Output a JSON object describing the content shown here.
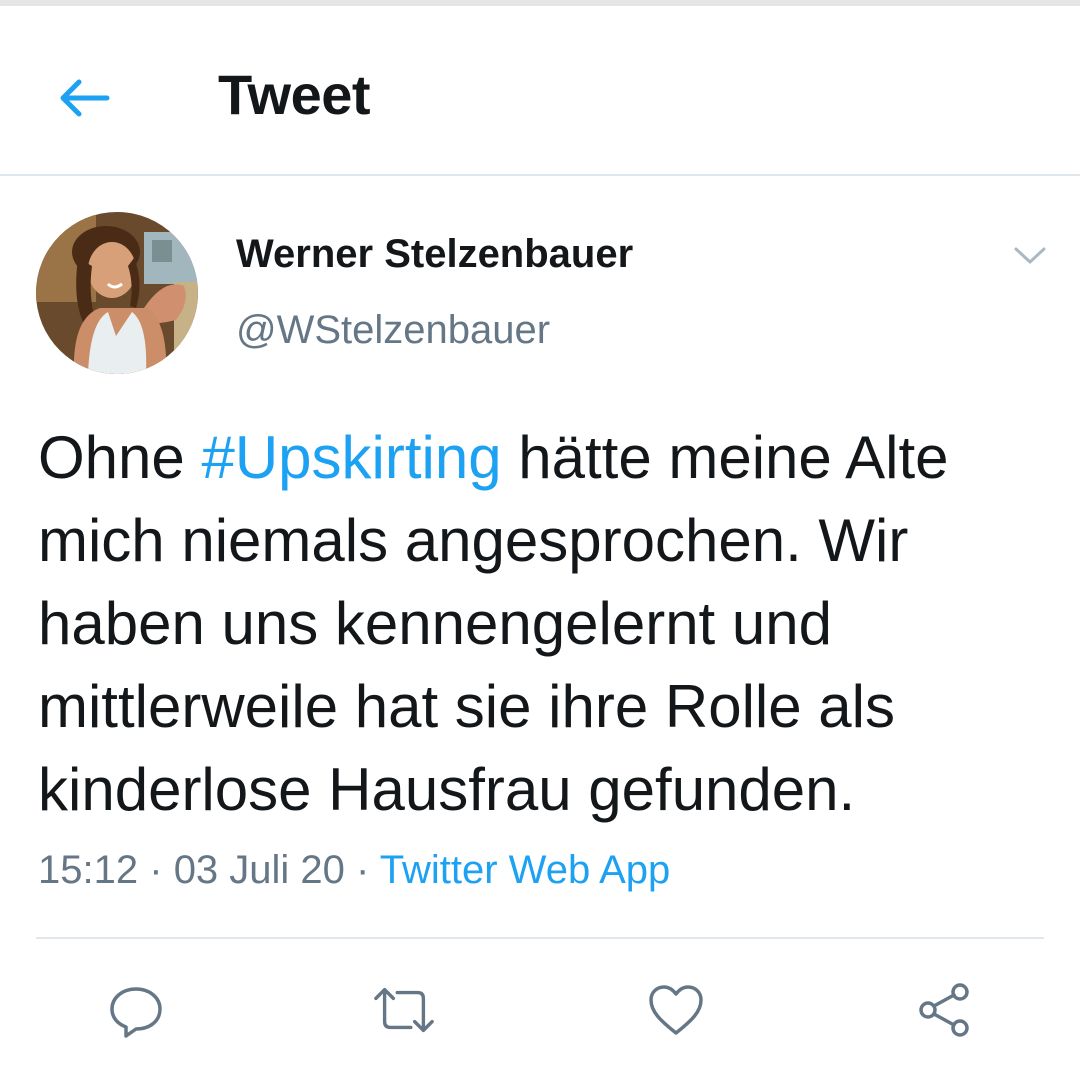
{
  "header": {
    "title": "Tweet",
    "back_icon": "arrow-left-icon"
  },
  "tweet": {
    "author": {
      "display_name": "Werner Stelzenbauer",
      "handle": "@WStelzenbauer"
    },
    "text": {
      "before": "Ohne ",
      "hashtag": "#Upskirting",
      "after": " hätte meine Alte mich niemals angesprochen. Wir haben uns kennengelernt und mittlerweile hat sie ihre Rolle als kinderlose Hausfrau gefunden."
    },
    "time": "15:12",
    "separator": "·",
    "date": "03 Juli 20",
    "source": "Twitter Web App"
  },
  "actions": [
    "reply-icon",
    "retweet-icon",
    "like-icon",
    "share-icon"
  ],
  "colors": {
    "accent": "#1da1f2",
    "text": "#14171a",
    "secondary": "#657786",
    "border": "#e1e8ed"
  }
}
